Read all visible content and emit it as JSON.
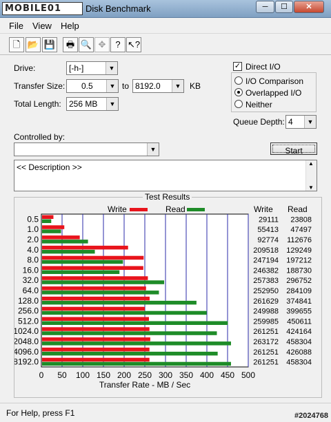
{
  "window": {
    "logo_text": "MOBILE01",
    "title": "Disk Benchmark",
    "minimize_glyph": "─",
    "maximize_glyph": "☐",
    "close_glyph": "✕"
  },
  "menu": {
    "file": "File",
    "view": "View",
    "help": "Help"
  },
  "toolbar": {
    "icons": [
      "new-document-icon",
      "open-folder-icon",
      "save-icon",
      "print-icon",
      "print-preview-icon",
      "move-icon",
      "help-icon",
      "context-help-icon"
    ],
    "glyphs": [
      "🗋",
      "📂",
      "💾",
      "🖶",
      "🔍",
      "✥",
      "?",
      "↖?"
    ]
  },
  "settings": {
    "drive_label": "Drive:",
    "drive_value": "[-h-]",
    "transfer_size_label": "Transfer Size:",
    "transfer_from": "0.5",
    "to_label": "to",
    "transfer_to": "8192.0",
    "unit": "KB",
    "total_length_label": "Total Length:",
    "total_length_value": "256 MB",
    "controlled_by_label": "Controlled by:",
    "controlled_by_value": "",
    "description": "<< Description >>"
  },
  "io_options": {
    "direct_io_label": "Direct I/O",
    "direct_io_checked": true,
    "io_comparison": "I/O Comparison",
    "overlapped_io": "Overlapped I/O",
    "neither": "Neither",
    "selected": "Overlapped I/O",
    "queue_depth_label": "Queue Depth:",
    "queue_depth_value": "4"
  },
  "start_button": "Start",
  "chart_data": {
    "type": "bar",
    "title": "Test Results",
    "xlabel": "Transfer Rate - MB / Sec",
    "xlim": [
      0,
      500
    ],
    "xticks": [
      0,
      50,
      100,
      150,
      200,
      250,
      300,
      350,
      400,
      450,
      500
    ],
    "categories": [
      "0.5",
      "1.0",
      "2.0",
      "4.0",
      "8.0",
      "16.0",
      "32.0",
      "64.0",
      "128.0",
      "256.0",
      "512.0",
      "1024.0",
      "2048.0",
      "4096.0",
      "8192.0"
    ],
    "series": [
      {
        "name": "Write",
        "color": "#e8141c",
        "values": [
          29111,
          55413,
          92774,
          209518,
          247194,
          246382,
          257383,
          252950,
          261629,
          249988,
          259985,
          261251,
          263172,
          261251,
          261251
        ]
      },
      {
        "name": "Read",
        "color": "#1e8c28",
        "values": [
          23808,
          47497,
          112676,
          129249,
          197212,
          188730,
          296752,
          284109,
          374841,
          399655,
          450611,
          424164,
          458304,
          426088,
          458304
        ]
      }
    ],
    "table_headers": [
      "Write",
      "Read"
    ]
  },
  "status": {
    "text": "For Help, press F1",
    "watermark": "#2024768"
  }
}
